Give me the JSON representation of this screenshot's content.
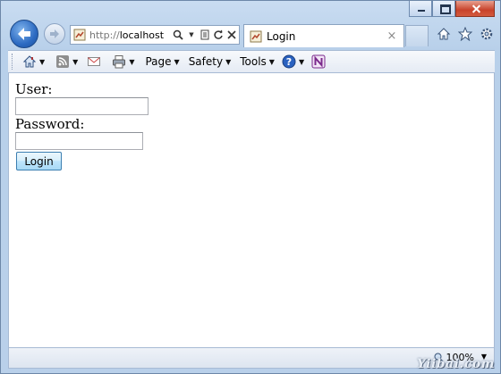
{
  "browser": {
    "url_prefix": "http://",
    "url_host": "localhost",
    "tab_title": "Login",
    "tab_close": "×",
    "zoom": "100%"
  },
  "command_bar": {
    "page_label": "Page",
    "safety_label": "Safety",
    "tools_label": "Tools"
  },
  "form": {
    "user_label": "User:",
    "user_value": "",
    "password_label": "Password:",
    "password_value": "",
    "login_button": "Login"
  },
  "watermark": "Yiibai.com",
  "colors": {
    "chrome": "#b9d0ea",
    "close_button": "#c8432b",
    "accent_blue": "#2d6bc2"
  }
}
